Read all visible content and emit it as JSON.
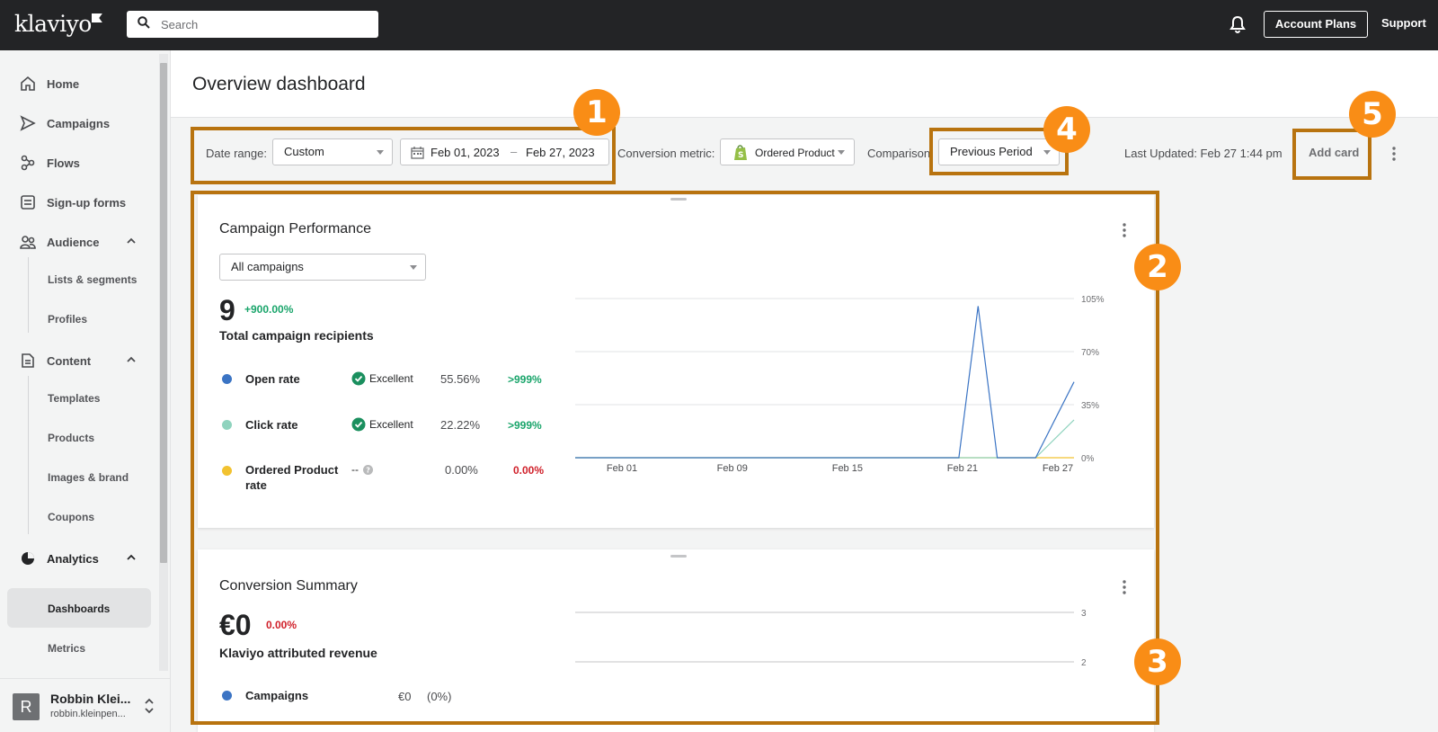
{
  "app": {
    "logo": "klaviyo",
    "search_placeholder": "Search",
    "account_plans": "Account Plans",
    "support": "Support"
  },
  "sidebar": {
    "items": [
      {
        "label": "Home"
      },
      {
        "label": "Campaigns"
      },
      {
        "label": "Flows"
      },
      {
        "label": "Sign-up forms"
      },
      {
        "label": "Audience"
      },
      {
        "label": "Content"
      },
      {
        "label": "Analytics"
      }
    ],
    "audience_sub": [
      "Lists & segments",
      "Profiles"
    ],
    "content_sub": [
      "Templates",
      "Products",
      "Images & brand",
      "Coupons"
    ],
    "analytics_sub": [
      "Dashboards",
      "Metrics"
    ],
    "user": {
      "initial": "R",
      "name": "Robbin Klei...",
      "email": "robbin.kleinpen..."
    }
  },
  "page": {
    "title": "Overview dashboard"
  },
  "toolbar": {
    "date_range_label": "Date range:",
    "date_range_value": "Custom",
    "date_from": "Feb 01, 2023",
    "date_sep": "–",
    "date_to": "Feb 27, 2023",
    "conversion_label": "Conversion metric:",
    "conversion_value": "Ordered Product",
    "comparison_label": "Comparison",
    "comparison_value": "Previous Period",
    "last_updated": "Last Updated: Feb 27 1:44 pm",
    "add_card": "Add card"
  },
  "campaign_card": {
    "title": "Campaign Performance",
    "filter": "All campaigns",
    "total": "9",
    "total_delta": "+900.00%",
    "total_label": "Total campaign recipients",
    "rows": [
      {
        "label": "Open rate",
        "rating": "Excellent",
        "value": "55.56%",
        "delta": ">999%",
        "color": "#3b74c4"
      },
      {
        "label": "Click rate",
        "rating": "Excellent",
        "value": "22.22%",
        "delta": ">999%",
        "color": "#8fd3be"
      },
      {
        "label": "Ordered Product rate",
        "rating": "--",
        "value": "0.00%",
        "delta": "0.00%",
        "color": "#f2c230"
      }
    ]
  },
  "conversion_card": {
    "title": "Conversion Summary",
    "total": "€0",
    "total_delta": "0.00%",
    "total_label": "Klaviyo attributed revenue",
    "rows": [
      {
        "label": "Campaigns",
        "value": "€0",
        "share": "(0%)",
        "color": "#3b74c4"
      }
    ]
  },
  "chart_data": [
    {
      "type": "line",
      "x_tick_labels": [
        "Feb 01",
        "Feb 09",
        "Feb 15",
        "Feb 21",
        "Feb 27"
      ],
      "y_tick_labels": [
        "0%",
        "35%",
        "70%",
        "105%"
      ],
      "ylim": [
        0,
        105
      ],
      "x": [
        "Feb 01",
        "Feb 21",
        "Feb 22",
        "Feb 23",
        "Feb 25",
        "Feb 27"
      ],
      "series": [
        {
          "name": "Open rate",
          "color": "#3b74c4",
          "values": [
            0,
            0,
            100,
            0,
            0,
            50
          ]
        },
        {
          "name": "Click rate",
          "color": "#8fd3be",
          "values": [
            0,
            0,
            0,
            0,
            0,
            25
          ]
        },
        {
          "name": "Ordered Product rate",
          "color": "#f2c230",
          "values": [
            0,
            0,
            0,
            0,
            0,
            0
          ]
        }
      ]
    },
    {
      "type": "line",
      "y_tick_labels": [
        "3",
        "2"
      ]
    }
  ],
  "annotations": [
    "1",
    "2",
    "3",
    "4",
    "5"
  ]
}
